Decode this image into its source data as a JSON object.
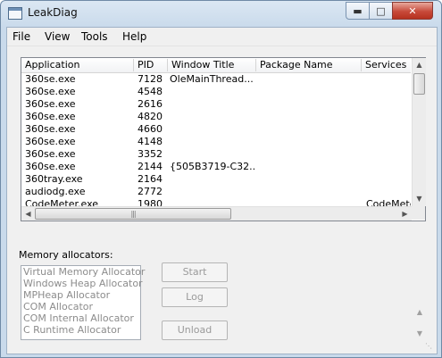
{
  "window": {
    "title": "LeakDiag"
  },
  "menu": [
    "File",
    "View",
    "Tools",
    "Help"
  ],
  "columns": [
    "Application",
    "PID",
    "Window Title",
    "Package Name",
    "Services"
  ],
  "rows": [
    {
      "app": "360se.exe",
      "pid": "7128",
      "win": "OleMainThread...",
      "pkg": "",
      "svc": ""
    },
    {
      "app": "360se.exe",
      "pid": "4548",
      "win": "",
      "pkg": "",
      "svc": ""
    },
    {
      "app": "360se.exe",
      "pid": "2616",
      "win": "",
      "pkg": "",
      "svc": ""
    },
    {
      "app": "360se.exe",
      "pid": "4820",
      "win": "",
      "pkg": "",
      "svc": ""
    },
    {
      "app": "360se.exe",
      "pid": "4660",
      "win": "",
      "pkg": "",
      "svc": ""
    },
    {
      "app": "360se.exe",
      "pid": "4148",
      "win": "",
      "pkg": "",
      "svc": ""
    },
    {
      "app": "360se.exe",
      "pid": "3352",
      "win": "",
      "pkg": "",
      "svc": ""
    },
    {
      "app": "360se.exe",
      "pid": "2144",
      "win": "{505B3719-C32...",
      "pkg": "",
      "svc": ""
    },
    {
      "app": "360tray.exe",
      "pid": "2164",
      "win": "",
      "pkg": "",
      "svc": ""
    },
    {
      "app": "audiodg.exe",
      "pid": "2772",
      "win": "",
      "pkg": "",
      "svc": ""
    },
    {
      "app": "CodeMeter.exe",
      "pid": "1980",
      "win": "",
      "pkg": "",
      "svc": "CodeMeter"
    }
  ],
  "memory": {
    "label": "Memory allocators:",
    "allocators": [
      "Virtual Memory Allocator",
      "Windows Heap Allocator",
      "MPHeap Allocator",
      "COM Allocator",
      "COM Internal Allocator",
      "C Runtime Allocator"
    ]
  },
  "buttons": {
    "start": "Start",
    "log": "Log",
    "unload": "Unload"
  },
  "icons": {
    "app": "app-window-icon",
    "minimize": "minimize-icon",
    "maximize": "maximize-icon",
    "close": "close-icon",
    "scroll_up": "chevron-up-icon",
    "scroll_down": "chevron-down-icon",
    "scroll_left": "chevron-left-icon",
    "scroll_right": "chevron-right-icon",
    "grip": "resize-grip-icon"
  },
  "colors": {
    "titlebar": "#c9daeb",
    "close_button": "#c74a3a",
    "disabled_text": "#8c8c8c"
  }
}
